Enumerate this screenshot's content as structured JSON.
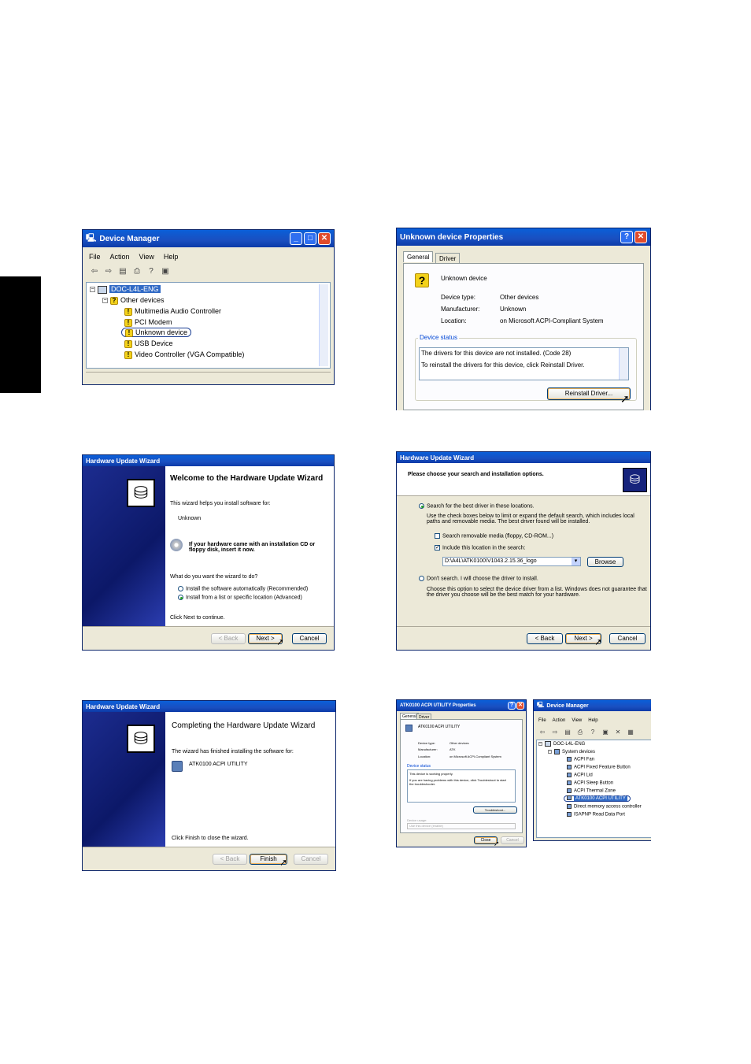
{
  "device_manager": {
    "title": "Device Manager",
    "menu": [
      "File",
      "Action",
      "View",
      "Help"
    ],
    "tree": {
      "root": "DOC-L4L-ENG",
      "group": "Other devices",
      "items": [
        "Multimedia Audio Controller",
        "PCI Modem",
        "Unknown device",
        "USB Device",
        "Video Controller (VGA Compatible)"
      ]
    }
  },
  "unknown_props": {
    "title": "Unknown device Properties",
    "tabs": [
      "General",
      "Driver"
    ],
    "device_name": "Unknown device",
    "fields": [
      {
        "label": "Device type:",
        "value": "Other devices"
      },
      {
        "label": "Manufacturer:",
        "value": "Unknown"
      },
      {
        "label": "Location:",
        "value": "on Microsoft ACPI-Compliant System"
      }
    ],
    "status_label": "Device status",
    "status_lines": [
      "The drivers for this device are not installed. (Code 28)",
      "To reinstall the drivers for this device, click Reinstall Driver."
    ],
    "reinstall_button": "Reinstall Driver..."
  },
  "wizard_welcome": {
    "title": "Hardware Update Wizard",
    "heading": "Welcome to the Hardware Update Wizard",
    "intro": "This wizard helps you install software for:",
    "device": "Unknown",
    "cd_note": "If your hardware came with an installation CD or floppy disk, insert it now.",
    "question": "What do you want the wizard to do?",
    "options": [
      "Install the software automatically (Recommended)",
      "Install from a list or specific location (Advanced)"
    ],
    "continue": "Click Next to continue.",
    "buttons": {
      "back": "< Back",
      "next": "Next >",
      "cancel": "Cancel"
    }
  },
  "wizard_search": {
    "title": "Hardware Update Wizard",
    "heading": "Please choose your search and installation options.",
    "opt1": "Search for the best driver in these locations.",
    "opt1_desc": "Use the check boxes below to limit or expand the default search, which includes local paths and removable media. The best driver found will be installed.",
    "check1": "Search removable media (floppy, CD-ROM...)",
    "check2": "Include this location in the search:",
    "path": "D:\\A4L\\ATK0100\\V1043.2.15.36_logo",
    "browse": "Browse",
    "opt2": "Don't search. I will choose the driver to install.",
    "opt2_desc": "Choose this option to select the device driver from a list. Windows does not guarantee that the driver you choose will be the best match for your hardware.",
    "buttons": {
      "back": "< Back",
      "next": "Next >",
      "cancel": "Cancel"
    }
  },
  "wizard_complete": {
    "title": "Hardware Update Wizard",
    "heading": "Completing the Hardware Update Wizard",
    "text": "The wizard has finished installing the software for:",
    "device": "ATK0100 ACPI UTILITY",
    "finish_note": "Click Finish to close the wizard.",
    "buttons": {
      "back": "< Back",
      "finish": "Finish",
      "cancel": "Cancel"
    }
  },
  "atk_props": {
    "title": "ATK0100 ACPI UTILITY Properties",
    "tabs": [
      "General",
      "Driver"
    ],
    "device_name": "ATK0100 ACPI UTILITY",
    "fields": [
      {
        "label": "Device type:",
        "value": "Other devices"
      },
      {
        "label": "Manufacturer:",
        "value": "ATK"
      },
      {
        "label": "Location:",
        "value": "on Microsoft ACPI-Compliant System"
      }
    ],
    "status_label": "Device status",
    "status_lines": [
      "This device is working properly.",
      "If you are having problems with this device, click Troubleshoot to start the troubleshooter."
    ],
    "troubleshoot": "Troubleshoot...",
    "usage_label": "Device usage:",
    "usage_value": "Use this device (enable)",
    "close": "Close",
    "cancel": "Cancel"
  },
  "device_manager2": {
    "title": "Device Manager",
    "menu": [
      "File",
      "Action",
      "View",
      "Help"
    ],
    "tree": {
      "root": "DOC-L4L-ENG",
      "group": "System devices",
      "items": [
        "ACPI Fan",
        "ACPI Fixed Feature Button",
        "ACPI Lid",
        "ACPI Sleep Button",
        "ACPI Thermal Zone",
        "ATK0100 ACPI UTILITY",
        "Direct memory access controller",
        "ISAPNP Read Data Port"
      ]
    }
  }
}
